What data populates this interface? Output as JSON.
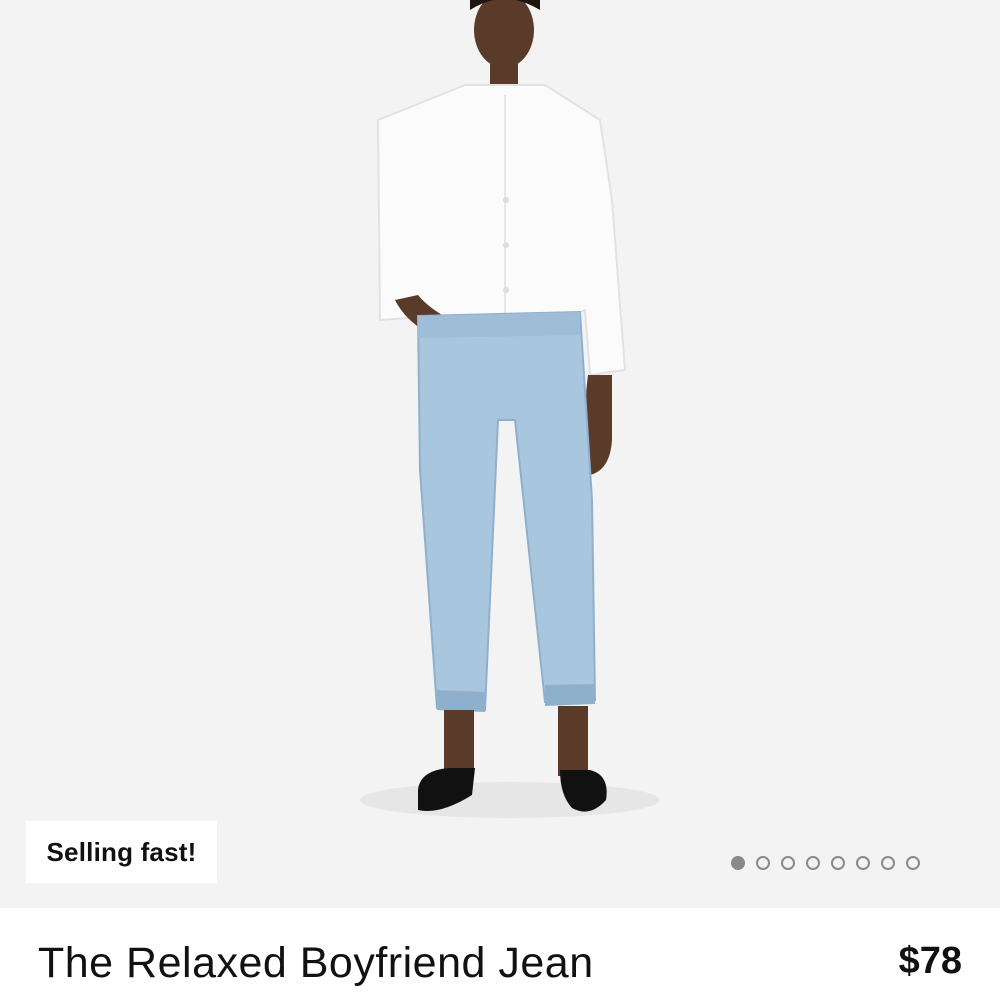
{
  "product": {
    "name": "The Relaxed Boyfriend Jean",
    "price": "$78",
    "badge": "Selling fast!",
    "image": {
      "alt_icon": "product-photo",
      "background_color": "#f3f3f3"
    },
    "carousel": {
      "total": 8,
      "active_index": 0
    }
  }
}
